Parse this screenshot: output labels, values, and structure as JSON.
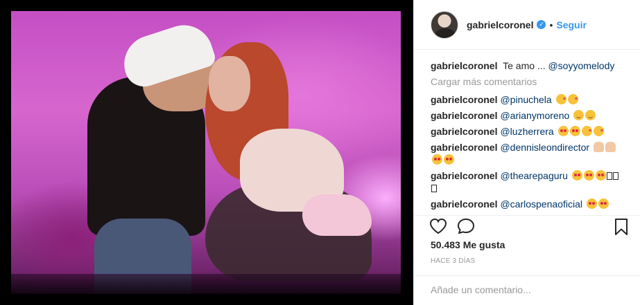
{
  "post": {
    "username": "gabrielcoronel",
    "separator": "•",
    "follow_label": "Seguir",
    "verified_glyph": "✓",
    "caption": {
      "user": "gabrielcoronel",
      "text": "Te amo ...",
      "mention": "@soyyomelody"
    },
    "load_more_label": "Cargar más comentarios",
    "comments": [
      {
        "user": "gabrielcoronel",
        "mention": "@pinuchela",
        "emojis": [
          "kiss",
          "kiss"
        ]
      },
      {
        "user": "gabrielcoronel",
        "mention": "@arianymoreno",
        "emojis": [
          "smile",
          "smile"
        ]
      },
      {
        "user": "gabrielcoronel",
        "mention": "@luzherrera",
        "emojis": [
          "heart",
          "heart",
          "kiss",
          "kiss"
        ]
      },
      {
        "user": "gabrielcoronel",
        "mention": "@dennisleondirector",
        "emojis": [
          "pray",
          "pray",
          "heart",
          "heart"
        ]
      },
      {
        "user": "gabrielcoronel",
        "mention": "@thearepaguru",
        "emojis": [
          "heart",
          "heart",
          "heart",
          "box",
          "box",
          "box"
        ]
      },
      {
        "user": "gabrielcoronel",
        "mention": "@carlospenaoficial",
        "emojis": [
          "heart",
          "heart"
        ]
      }
    ],
    "likes_label": "50.483 Me gusta",
    "time_ago": "HACE 3 DÍAS",
    "add_comment_placeholder": "Añade un comentario..."
  },
  "icons": {
    "like": "heart-outline-icon",
    "comment": "comment-bubble-icon",
    "save": "bookmark-icon",
    "verified": "verified-badge-icon"
  },
  "colors": {
    "link_blue": "#3897f0",
    "mention_blue": "#003569",
    "muted": "#999999",
    "text": "#262626",
    "verified": "#3897f0"
  }
}
